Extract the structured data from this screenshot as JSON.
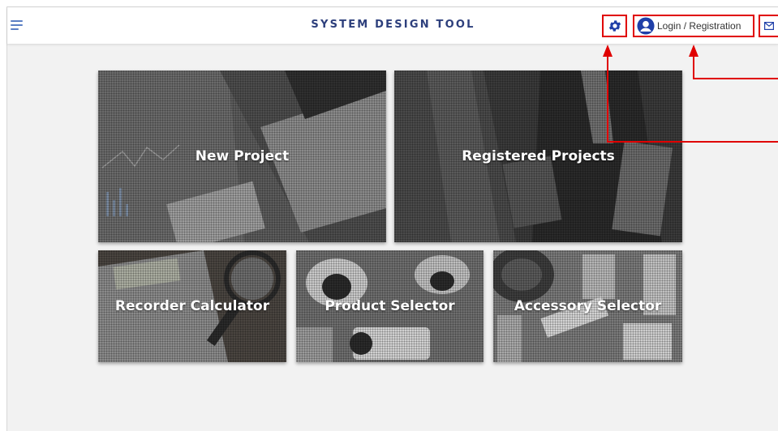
{
  "header": {
    "title": "SYSTEM DESIGN TOOL",
    "login_label": "Login / Registration",
    "icons": [
      "menu-icon",
      "gear-icon",
      "user-icon",
      "mail-icon"
    ]
  },
  "tiles": [
    {
      "label": "New Project"
    },
    {
      "label": "Registered Projects"
    },
    {
      "label": "Recorder Calculator"
    },
    {
      "label": "Product Selector"
    },
    {
      "label": "Accessory Selector"
    }
  ],
  "colors": {
    "title": "#2d3f7c",
    "icon_blue": "#1f3fa8",
    "menu_blue": "#5b7fc4",
    "annotation_red": "#e00000",
    "background": "#f2f2f2"
  }
}
